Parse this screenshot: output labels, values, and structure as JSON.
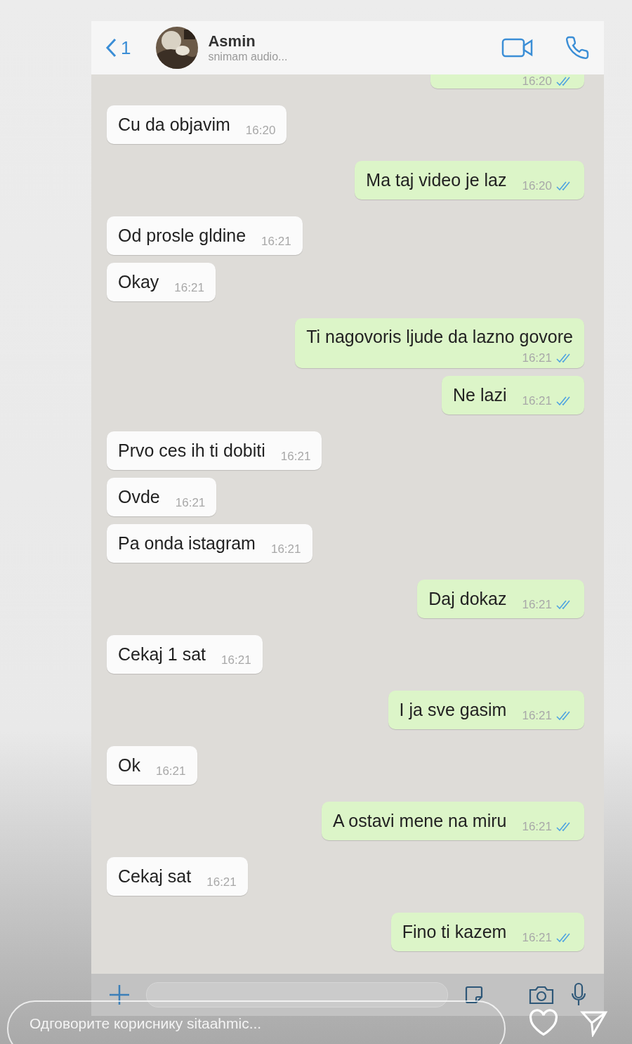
{
  "header": {
    "back_count": "1",
    "name": "Asmin",
    "status": "snimam audio..."
  },
  "messages": [
    {
      "kind": "outgoing",
      "time": "16:20",
      "read": true,
      "cut": true
    },
    {
      "kind": "incoming",
      "text": "Cu da objavim",
      "time": "16:20"
    },
    {
      "kind": "outgoing",
      "text": "Ma taj video je laz",
      "time": "16:20",
      "read": true
    },
    {
      "kind": "incoming",
      "text": "Od prosle gldine",
      "time": "16:21"
    },
    {
      "kind": "incoming",
      "text": "Okay",
      "time": "16:21"
    },
    {
      "kind": "outgoing",
      "text": "Ti nagovoris ljude da lazno govore",
      "time": "16:21",
      "read": true,
      "wrap": true
    },
    {
      "kind": "outgoing",
      "text": "Ne lazi",
      "time": "16:21",
      "read": true
    },
    {
      "kind": "incoming",
      "text": "Prvo ces ih ti dobiti",
      "time": "16:21"
    },
    {
      "kind": "incoming",
      "text": "Ovde",
      "time": "16:21"
    },
    {
      "kind": "incoming",
      "text": "Pa onda istagram",
      "time": "16:21"
    },
    {
      "kind": "outgoing",
      "text": "Daj dokaz",
      "time": "16:21",
      "read": true
    },
    {
      "kind": "incoming",
      "text": "Cekaj 1 sat",
      "time": "16:21"
    },
    {
      "kind": "outgoing",
      "text": "I ja sve gasim",
      "time": "16:21",
      "read": true
    },
    {
      "kind": "incoming",
      "text": "Ok",
      "time": "16:21"
    },
    {
      "kind": "outgoing",
      "text": "A ostavi mene na miru",
      "time": "16:21",
      "read": true
    },
    {
      "kind": "incoming",
      "text": "Cekaj sat",
      "time": "16:21"
    },
    {
      "kind": "outgoing",
      "text": "Fino ti kazem",
      "time": "16:21",
      "read": true
    }
  ],
  "story_reply": {
    "placeholder": "Одговорите кориснику sitaahmic..."
  }
}
